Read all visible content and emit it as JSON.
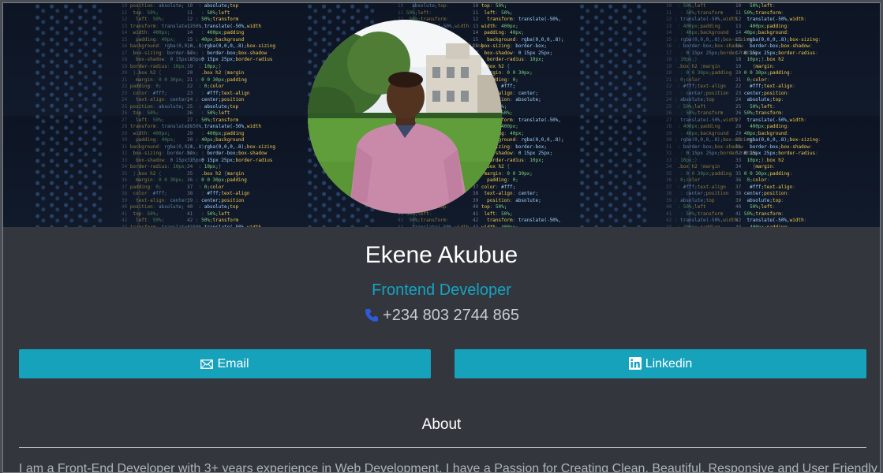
{
  "profile": {
    "name": "Ekene Akubue",
    "role": "Frontend Developer",
    "phone": "+234 803 2744 865"
  },
  "actions": {
    "email_label": "Email",
    "linkedin_label": "Linkedin"
  },
  "about": {
    "title": "About",
    "text": "I am a Front-End Developer with 3+ years experience in Web Development. I have a Passion for Creating Clean, Beautiful, Responsive and User Friendly"
  },
  "colors": {
    "accent": "#17a2bc",
    "card_background": "#33373d",
    "phone_icon": "#2d5bd8"
  },
  "icons": {
    "phone": "phone-icon",
    "email": "envelope-icon",
    "linkedin": "linkedin-icon"
  }
}
